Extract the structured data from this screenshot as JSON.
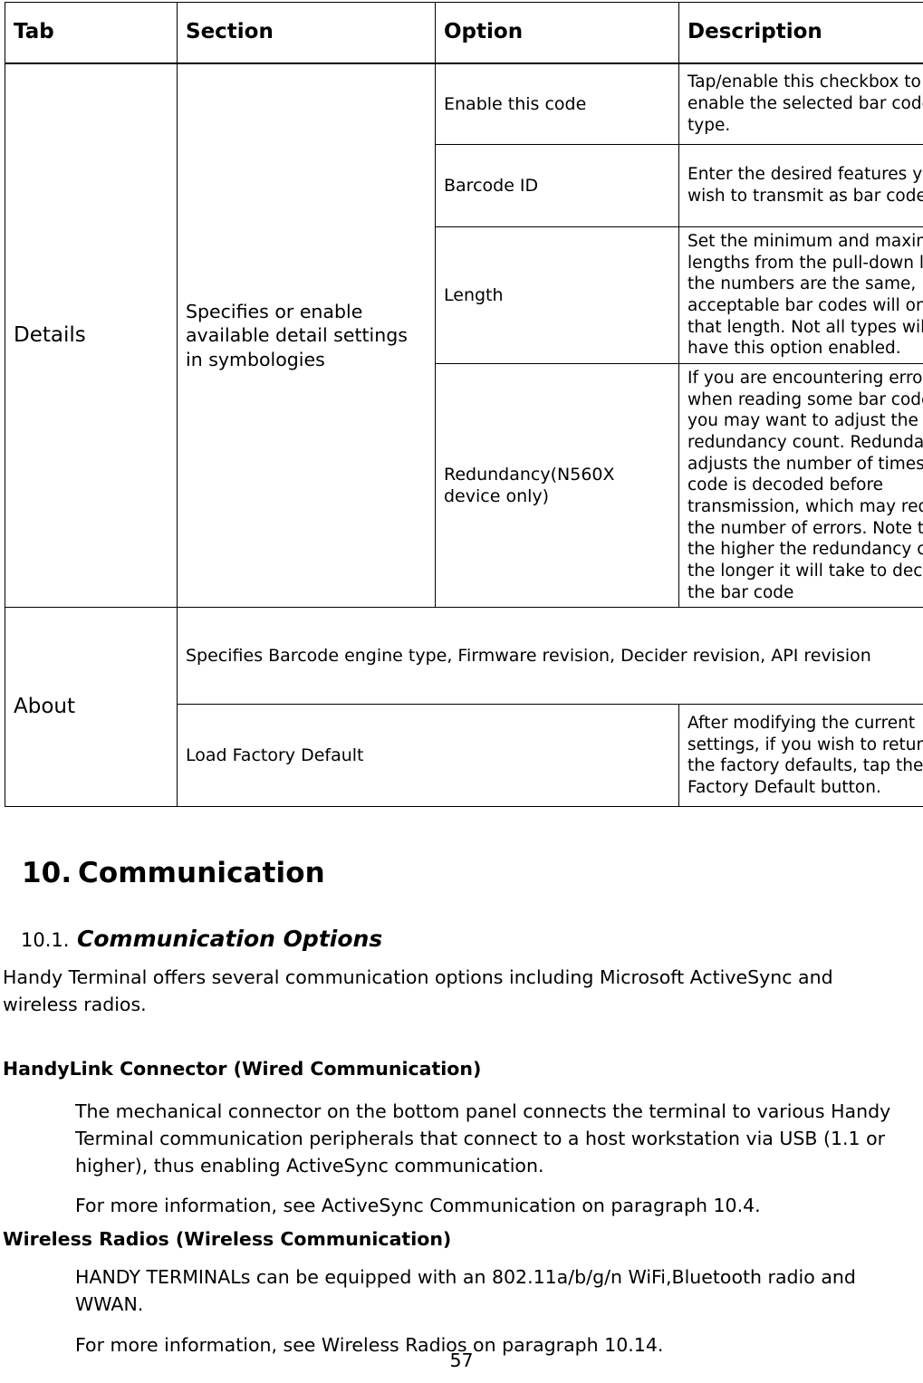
{
  "table": {
    "headers": [
      "Tab",
      "Section",
      "Option",
      "Description"
    ],
    "groups": [
      {
        "tab": "Details",
        "section": "Specifies or enable available detail settings in symbologies",
        "rows": [
          {
            "option": "Enable this code",
            "description": "Tap/enable this checkbox to enable the selected bar code type."
          },
          {
            "option": "Barcode ID",
            "description": "Enter the desired features you wish to transmit as bar code ID"
          },
          {
            "option": "Length",
            "description": "Set the minimum and maximum lengths from the pull-down lists. If the numbers are the same, acceptable bar codes will only be that length. Not all types will have this option enabled."
          },
          {
            "option": "Redundancy(N560X device only)",
            "description": "If you are encountering errors when reading some bar codes, you may want to adjust the redundancy count. Redundancy adjusts the number of times a bar code is decoded before transmission, which may reduce the number of errors. Note that the higher the redundancy count, the longer it will take to decode the bar code"
          }
        ]
      },
      {
        "tab": "About",
        "full_row": "Specifies Barcode engine type, Firmware revision, Decider revision, API revision",
        "rows": [
          {
            "option": "Load Factory Default",
            "description": "After modifying the current settings, if you wish to return to the factory defaults, tap the Load Factory Default button."
          }
        ]
      }
    ]
  },
  "headings": {
    "chapter_number": "10.",
    "chapter_title": "Communication",
    "section_number": "10.1.",
    "section_title": "Communication Options"
  },
  "body": {
    "intro": "Handy Terminal offers several communication options including Microsoft ActiveSync and wireless radios.",
    "wired_heading": "HandyLink Connector (Wired Communication)",
    "wired_paragraph": "The mechanical connector on the bottom panel connects the terminal to various Handy Terminal communication peripherals that connect to a host workstation via USB (1.1 or higher), thus enabling ActiveSync communication.",
    "wired_more_info": "For more information, see ActiveSync Communication on paragraph 10.4.",
    "wireless_heading": "Wireless Radios (Wireless Communication)",
    "wireless_paragraph": "HANDY TERMINALs can be equipped with an 802.11a/b/g/n WiFi,Bluetooth radio and WWAN.",
    "wireless_more_info": "For more information, see Wireless Radios on paragraph 10.14."
  },
  "footer": {
    "page_number": "57"
  }
}
